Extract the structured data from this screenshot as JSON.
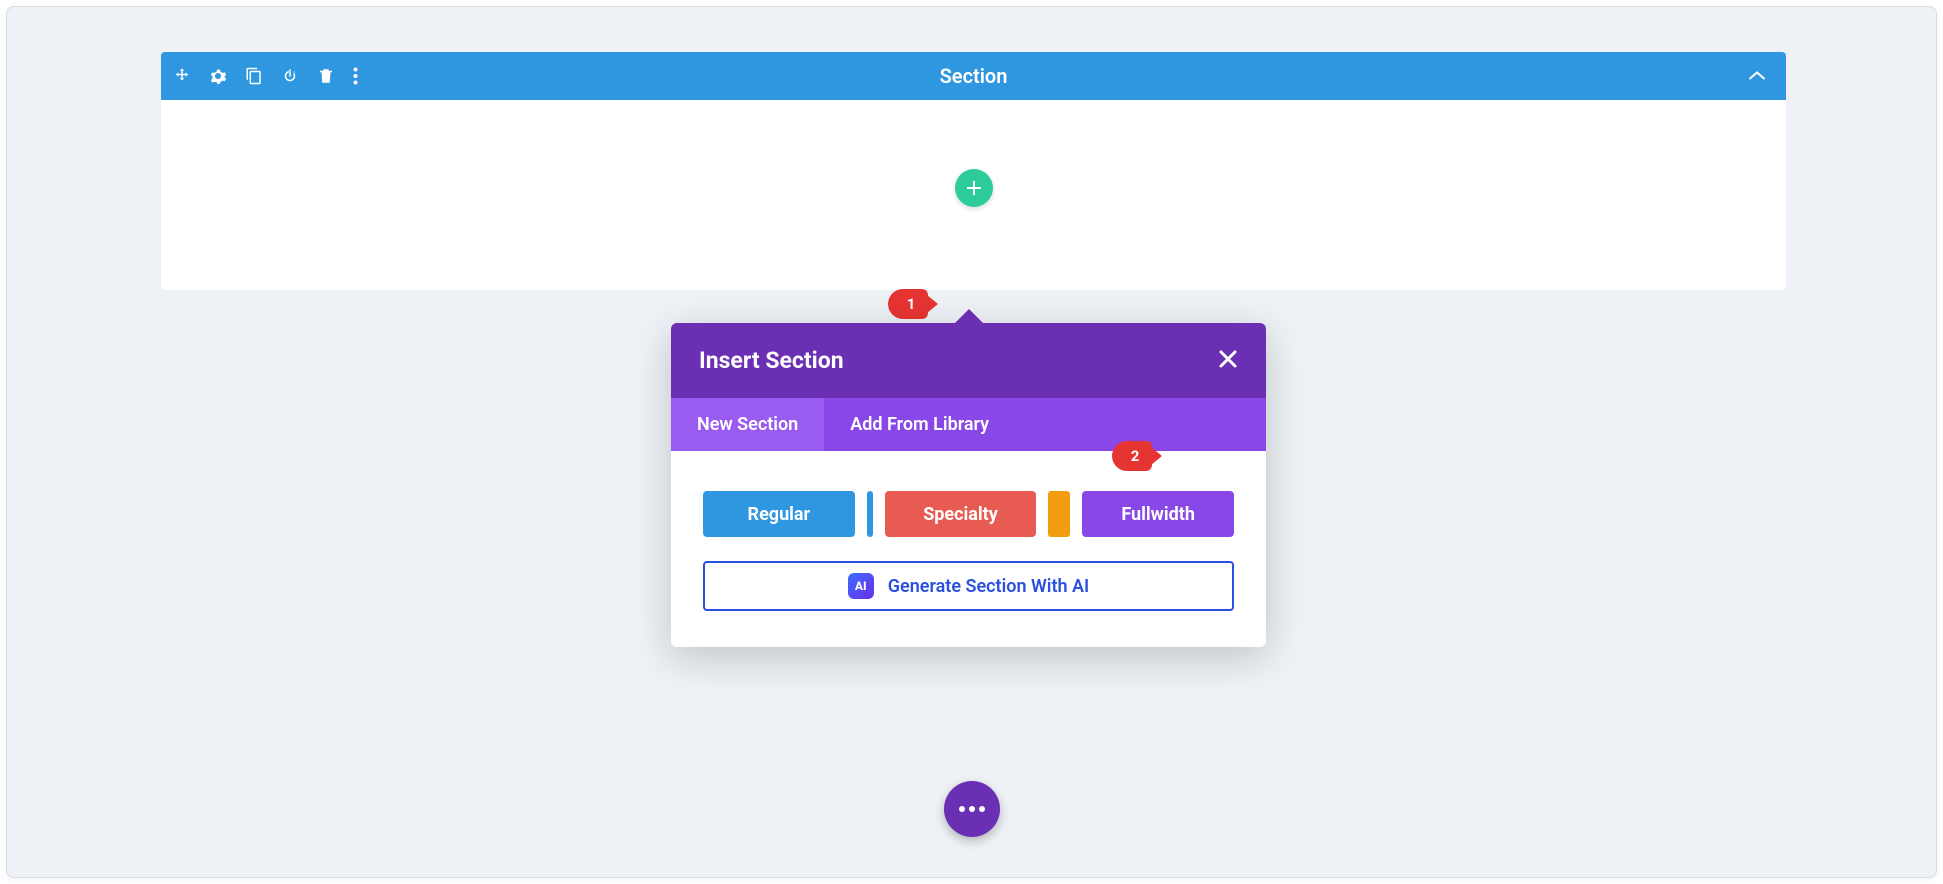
{
  "section": {
    "title": "Section"
  },
  "callouts": {
    "marker1": "1",
    "marker2": "2"
  },
  "modal": {
    "title": "Insert Section",
    "tabs": {
      "new": "New Section",
      "library": "Add From Library"
    },
    "types": {
      "regular": "Regular",
      "specialty": "Specialty",
      "fullwidth": "Fullwidth"
    },
    "ai": {
      "badge": "AI",
      "label": "Generate Section With AI"
    }
  }
}
